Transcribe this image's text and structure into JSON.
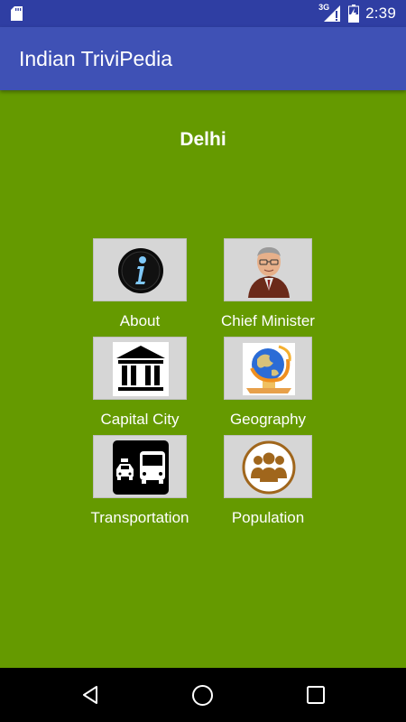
{
  "status_bar": {
    "time": "2:39",
    "network": "3G",
    "icons": [
      "sd-card-icon",
      "signal-icon",
      "battery-charging-icon"
    ]
  },
  "app_bar": {
    "title": "Indian TriviPedia"
  },
  "page": {
    "heading": "Delhi"
  },
  "tiles": [
    {
      "label": "About",
      "icon": "info-icon"
    },
    {
      "label": "Chief Minister",
      "icon": "chief-minister-portrait-icon"
    },
    {
      "label": "Capital City",
      "icon": "government-building-icon"
    },
    {
      "label": "Geography",
      "icon": "globe-icon"
    },
    {
      "label": "Transportation",
      "icon": "taxi-bus-icon"
    },
    {
      "label": "Population",
      "icon": "people-group-icon"
    }
  ],
  "nav_bar": {
    "icons": [
      "back-icon",
      "home-icon",
      "recents-icon"
    ]
  },
  "colors": {
    "status_bar": "#2f3ea3",
    "app_bar": "#3f51b5",
    "background": "#659a00",
    "tile": "#d6d6d6"
  }
}
